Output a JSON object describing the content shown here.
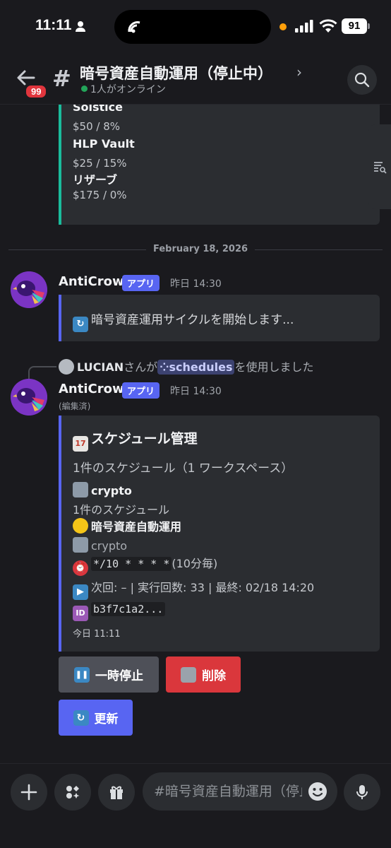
{
  "status_bar": {
    "time": "11:11",
    "battery": "91"
  },
  "header": {
    "unread_badge": "99",
    "channel_name": "暗号資産自動運用（停止中）",
    "online": "1人がオンライン"
  },
  "previous_embed": {
    "fields": [
      {
        "name": "Solstice",
        "value": "$50 / 8%"
      },
      {
        "name": "HLP Vault",
        "value": "$25 / 15%"
      },
      {
        "name": "リザーブ",
        "value": "$175 / 0%"
      }
    ]
  },
  "date_divider": "February 18, 2026",
  "message1": {
    "author": "AntiCrow",
    "tag": "アプリ",
    "timestamp": "昨日 14:30",
    "text": "暗号資産運用サイクルを開始します..."
  },
  "reply": {
    "user": "LUCIAN",
    "used_prefix": "さんが",
    "command": "schedules",
    "used_suffix": "を使用しました"
  },
  "message2": {
    "author": "AntiCrow",
    "tag": "アプリ",
    "timestamp": "昨日 14:30",
    "edited": "(編集済)",
    "embed": {
      "title": "スケジュール管理",
      "description": "1件のスケジュール（1 ワークスペース）",
      "folder_name": "crypto",
      "count_line": "1件のスケジュール",
      "schedule_name": "暗号資産自動運用",
      "schedule_folder": "crypto",
      "cron": "*/10 * * * *",
      "cron_desc": "(10分毎)",
      "next_line": "次回: – | 実行回数: 33 | 最終: 02/18 14:20",
      "id": "b3f7c1a2...",
      "footer": "今日 11:11"
    },
    "buttons": {
      "pause": "一時停止",
      "delete": "削除",
      "refresh": "更新"
    }
  },
  "input": {
    "placeholder": "#暗号資産自動運用（停止中）へメッセージを送信"
  },
  "colors": {
    "blurple": "#5865f2",
    "teal": "#1abc9c",
    "danger": "#da373c",
    "online": "#23a55a"
  }
}
